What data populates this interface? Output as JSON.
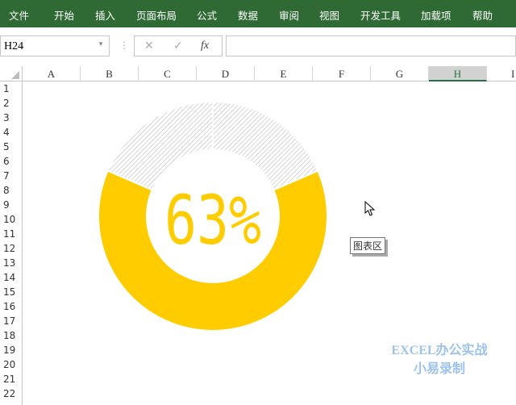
{
  "ribbon": {
    "tabs": [
      "文件",
      "开始",
      "插入",
      "页面布局",
      "公式",
      "数据",
      "审阅",
      "视图",
      "开发工具",
      "加载项",
      "帮助"
    ]
  },
  "formula_bar": {
    "name_box": "H24",
    "cancel": "✕",
    "enter": "✓",
    "fx": "fx",
    "value": ""
  },
  "columns": [
    "A",
    "B",
    "C",
    "D",
    "E",
    "F",
    "G",
    "H",
    "I"
  ],
  "selected_column": "H",
  "rows": [
    "1",
    "2",
    "3",
    "4",
    "5",
    "6",
    "7",
    "8",
    "9",
    "10",
    "11",
    "12",
    "13",
    "14",
    "15",
    "16",
    "17",
    "18",
    "19",
    "20",
    "21",
    "22"
  ],
  "chart": {
    "label": "63%",
    "percent": 63,
    "fill_color": "#ffcc00",
    "rest_color": "#d9d9d9"
  },
  "tooltip": "图表区",
  "watermark": {
    "line1": "EXCEL办公实战",
    "line2": "小易录制"
  }
}
